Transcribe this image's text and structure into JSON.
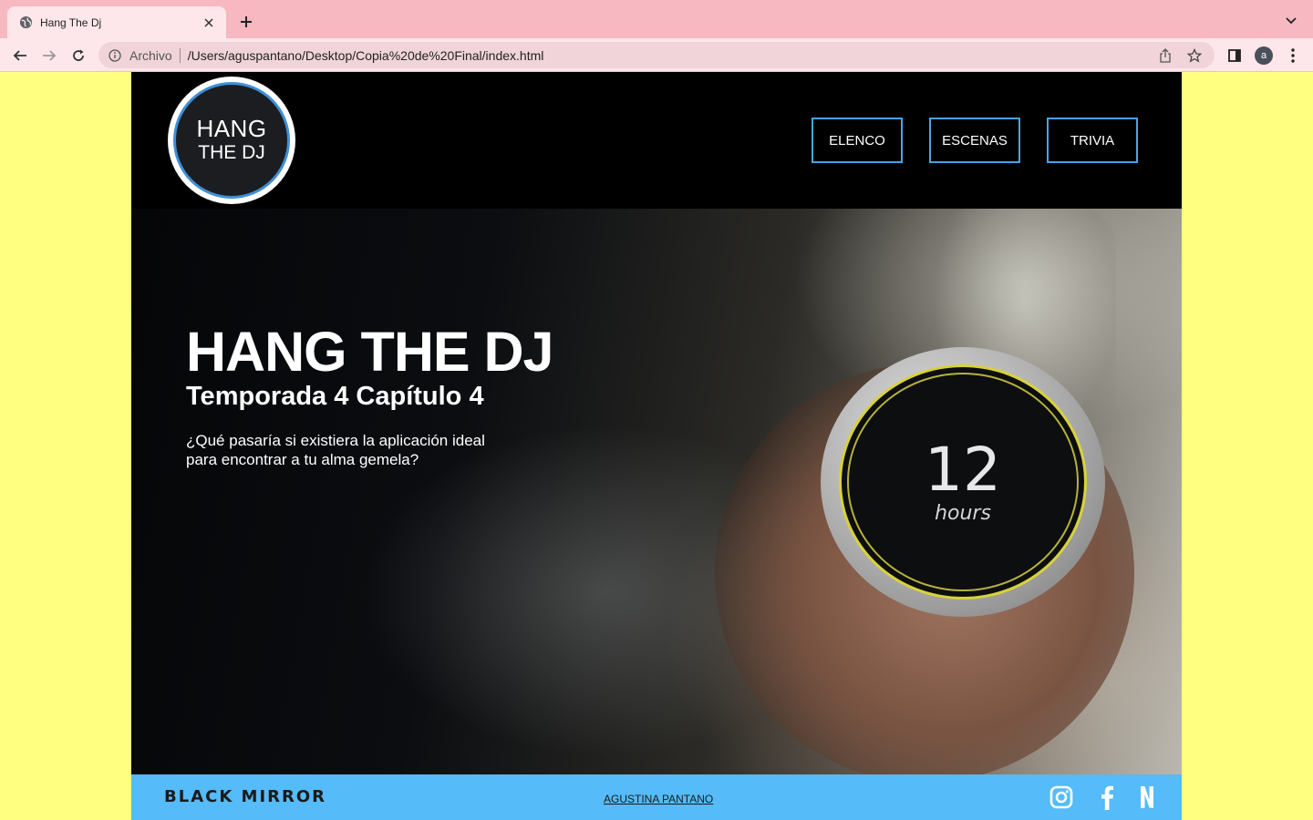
{
  "browser": {
    "tab": {
      "title": "Hang The Dj"
    },
    "omnibox": {
      "scheme_label": "Archivo",
      "url": "/Users/aguspantano/Desktop/Copia%20de%20Final/index.html"
    },
    "profile_initial": "a",
    "icons": [
      "globe-icon",
      "close-icon",
      "plus-icon",
      "chevron-down-icon",
      "back-arrow-icon",
      "forward-arrow-icon",
      "reload-icon",
      "info-icon",
      "share-icon",
      "star-icon",
      "side-panel-icon",
      "more-vertical-icon"
    ],
    "colors": {
      "tabbar": "#f7b8c2",
      "toolbar": "#fde7ea"
    }
  },
  "site": {
    "logo": {
      "line1": "HANG",
      "line2": "THE DJ"
    },
    "nav": [
      {
        "label": "ELENCO"
      },
      {
        "label": "ESCENAS"
      },
      {
        "label": "TRIVIA"
      }
    ],
    "hero": {
      "title": "HANG THE DJ",
      "subtitle": "Temporada 4 Capítulo 4",
      "tagline": "¿Qué pasaría si existiera la aplicación ideal para encontrar a tu alma gemela?",
      "device": {
        "number": "12",
        "unit": "hours"
      }
    },
    "footer": {
      "brand": "BLACK MIRROR",
      "author": "AGUSTINA PANTANO",
      "social_icons": [
        "instagram-icon",
        "facebook-icon",
        "netflix-icon"
      ]
    },
    "colors": {
      "page_bg": "#ffff80",
      "accent_border": "#4aa3e6",
      "footer": "#55bbf9"
    }
  }
}
